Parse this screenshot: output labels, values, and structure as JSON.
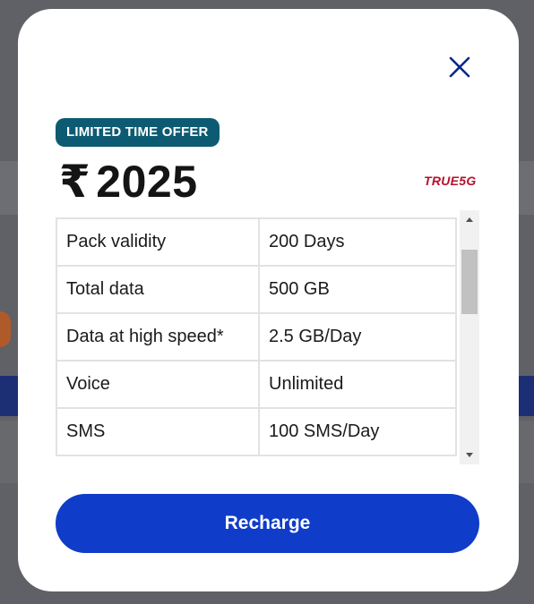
{
  "colors": {
    "accent": "#0f3cc9",
    "badge": "#0d5b72",
    "brand_red": "#b3122c",
    "close_icon": "#0a2a8a"
  },
  "modal": {
    "close_icon": "close-icon",
    "offer_badge": "LIMITED TIME OFFER",
    "price_symbol": "₹",
    "price_value": "2025",
    "network_tag": "TRUE5G",
    "benefits": [
      {
        "label": "Pack validity",
        "value": "200 Days"
      },
      {
        "label": "Total data",
        "value": "500 GB"
      },
      {
        "label": "Data at high speed*",
        "value": "2.5 GB/Day"
      },
      {
        "label": "Voice",
        "value": "Unlimited"
      },
      {
        "label": "SMS",
        "value": "100 SMS/Day"
      }
    ],
    "recharge_label": "Recharge"
  }
}
